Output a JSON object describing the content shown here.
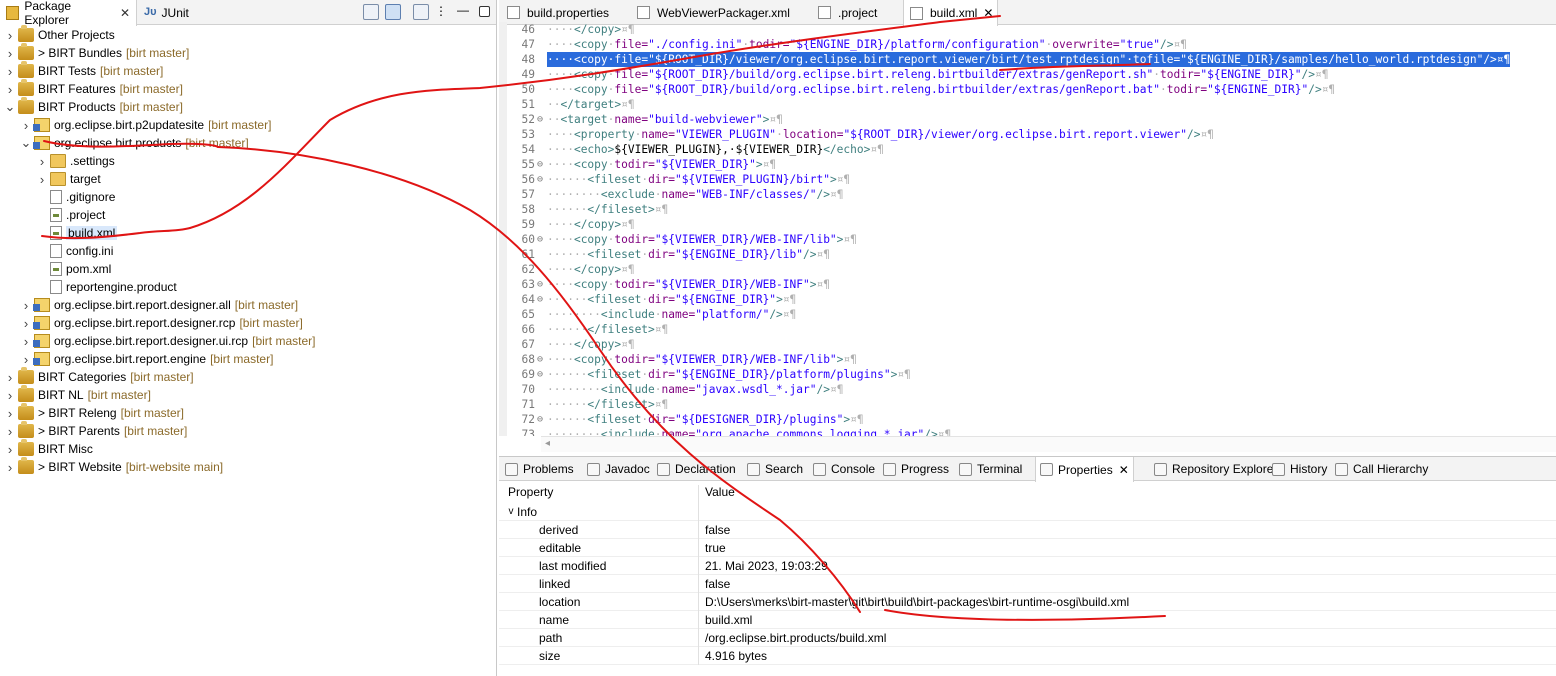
{
  "left_panel": {
    "tabs": [
      {
        "label": "Package Explorer",
        "active": true,
        "icon": "package-explorer-icon"
      },
      {
        "label": "JUnit",
        "active": false,
        "icon": "junit-icon"
      }
    ],
    "tree": [
      {
        "label": "Other Projects",
        "repo": "",
        "prefix": "",
        "level": 0,
        "arrow": ">",
        "icon": "ws"
      },
      {
        "label": "BIRT Bundles",
        "repo": "[birt master]",
        "prefix": "> ",
        "level": 0,
        "arrow": ">",
        "icon": "ws"
      },
      {
        "label": "BIRT Tests",
        "repo": "[birt master]",
        "prefix": "",
        "level": 0,
        "arrow": ">",
        "icon": "ws"
      },
      {
        "label": "BIRT Features",
        "repo": "[birt master]",
        "prefix": "",
        "level": 0,
        "arrow": ">",
        "icon": "ws"
      },
      {
        "label": "BIRT Products",
        "repo": "[birt master]",
        "prefix": "",
        "level": 0,
        "arrow": "v",
        "icon": "ws"
      },
      {
        "label": "org.eclipse.birt.p2updatesite",
        "repo": "[birt master]",
        "prefix": "",
        "level": 1,
        "arrow": ">",
        "icon": "proj"
      },
      {
        "label": "org.eclipse.birt.products",
        "repo": "[birt master]",
        "prefix": "",
        "level": 1,
        "arrow": "v",
        "icon": "proj"
      },
      {
        "label": ".settings",
        "repo": "",
        "prefix": "",
        "level": 2,
        "arrow": ">",
        "icon": "fold"
      },
      {
        "label": "target",
        "repo": "",
        "prefix": "",
        "level": 2,
        "arrow": ">",
        "icon": "fold"
      },
      {
        "label": ".gitignore",
        "repo": "",
        "prefix": "",
        "level": 2,
        "arrow": "",
        "icon": "file"
      },
      {
        "label": ".project",
        "repo": "",
        "prefix": "",
        "level": 2,
        "arrow": "",
        "icon": "xml"
      },
      {
        "label": "build.xml",
        "repo": "",
        "prefix": "",
        "level": 2,
        "arrow": "",
        "icon": "xml",
        "selected": true
      },
      {
        "label": "config.ini",
        "repo": "",
        "prefix": "",
        "level": 2,
        "arrow": "",
        "icon": "file"
      },
      {
        "label": "pom.xml",
        "repo": "",
        "prefix": "",
        "level": 2,
        "arrow": "",
        "icon": "xml"
      },
      {
        "label": "reportengine.product",
        "repo": "",
        "prefix": "",
        "level": 2,
        "arrow": "",
        "icon": "file"
      },
      {
        "label": "org.eclipse.birt.report.designer.all",
        "repo": "[birt master]",
        "prefix": "",
        "level": 1,
        "arrow": ">",
        "icon": "proj"
      },
      {
        "label": "org.eclipse.birt.report.designer.rcp",
        "repo": "[birt master]",
        "prefix": "",
        "level": 1,
        "arrow": ">",
        "icon": "proj"
      },
      {
        "label": "org.eclipse.birt.report.designer.ui.rcp",
        "repo": "[birt master]",
        "prefix": "",
        "level": 1,
        "arrow": ">",
        "icon": "proj"
      },
      {
        "label": "org.eclipse.birt.report.engine",
        "repo": "[birt master]",
        "prefix": "",
        "level": 1,
        "arrow": ">",
        "icon": "proj"
      },
      {
        "label": "BIRT Categories",
        "repo": "[birt master]",
        "prefix": "",
        "level": 0,
        "arrow": ">",
        "icon": "ws"
      },
      {
        "label": "BIRT NL",
        "repo": "[birt master]",
        "prefix": "",
        "level": 0,
        "arrow": ">",
        "icon": "ws"
      },
      {
        "label": "BIRT Releng",
        "repo": "[birt master]",
        "prefix": "> ",
        "level": 0,
        "arrow": ">",
        "icon": "ws"
      },
      {
        "label": "BIRT Parents",
        "repo": "[birt master]",
        "prefix": "> ",
        "level": 0,
        "arrow": ">",
        "icon": "ws"
      },
      {
        "label": "BIRT Misc",
        "repo": "",
        "prefix": "",
        "level": 0,
        "arrow": ">",
        "icon": "ws"
      },
      {
        "label": "BIRT Website",
        "repo": "[birt-website main]",
        "prefix": "> ",
        "level": 0,
        "arrow": ">",
        "icon": "ws"
      }
    ]
  },
  "editor": {
    "tabs": [
      {
        "label": "build.properties",
        "active": false
      },
      {
        "label": "WebViewerPackager.xml",
        "active": false
      },
      {
        "label": ".project",
        "active": false
      },
      {
        "label": "build.xml",
        "active": true
      }
    ],
    "lines": [
      {
        "n": "46",
        "fold": "",
        "ind": "····",
        "segs": [
          [
            "tg",
            "</copy>"
          ],
          [
            "ws",
            "¤¶"
          ]
        ]
      },
      {
        "n": "47",
        "fold": "",
        "ind": "····",
        "segs": [
          [
            "tg",
            "<copy"
          ],
          [
            "ws",
            "·"
          ],
          [
            "an",
            "file="
          ],
          [
            "av",
            "\"./config.ini\""
          ],
          [
            "ws",
            "·"
          ],
          [
            "an",
            "todir="
          ],
          [
            "av",
            "\"${ENGINE_DIR}/platform/configuration\""
          ],
          [
            "ws",
            "·"
          ],
          [
            "an",
            "overwrite="
          ],
          [
            "av",
            "\"true\""
          ],
          [
            "tg",
            "/>"
          ],
          [
            "ws",
            "¤¶"
          ]
        ]
      },
      {
        "n": "48",
        "fold": "",
        "ind": "····",
        "hl": true,
        "segs": [
          [
            "tg",
            "<copy"
          ],
          [
            "ws",
            "·"
          ],
          [
            "an",
            "file="
          ],
          [
            "av",
            "\"${ROOT_DIR}/viewer/org.eclipse.birt.report.viewer/birt/test.rptdesign\""
          ],
          [
            "ws",
            "·"
          ],
          [
            "an",
            "tofile="
          ],
          [
            "av",
            "\"${ENGINE_DIR}/samples/hello_world.rptdesign\""
          ],
          [
            "tg",
            "/>"
          ],
          [
            "ws",
            "¤¶"
          ]
        ]
      },
      {
        "n": "49",
        "fold": "",
        "ind": "····",
        "segs": [
          [
            "tg",
            "<copy"
          ],
          [
            "ws",
            "·"
          ],
          [
            "an",
            "file="
          ],
          [
            "av",
            "\"${ROOT_DIR}/build/org.eclipse.birt.releng.birtbuilder/extras/genReport.sh\""
          ],
          [
            "ws",
            "·"
          ],
          [
            "an",
            "todir="
          ],
          [
            "av",
            "\"${ENGINE_DIR}\""
          ],
          [
            "tg",
            "/>"
          ],
          [
            "ws",
            "¤¶"
          ]
        ]
      },
      {
        "n": "50",
        "fold": "",
        "ind": "····",
        "segs": [
          [
            "tg",
            "<copy"
          ],
          [
            "ws",
            "·"
          ],
          [
            "an",
            "file="
          ],
          [
            "av",
            "\"${ROOT_DIR}/build/org.eclipse.birt.releng.birtbuilder/extras/genReport.bat\""
          ],
          [
            "ws",
            "·"
          ],
          [
            "an",
            "todir="
          ],
          [
            "av",
            "\"${ENGINE_DIR}\""
          ],
          [
            "tg",
            "/>"
          ],
          [
            "ws",
            "¤¶"
          ]
        ]
      },
      {
        "n": "51",
        "fold": "",
        "ind": "··",
        "segs": [
          [
            "tg",
            "</target>"
          ],
          [
            "ws",
            "¤¶"
          ]
        ]
      },
      {
        "n": "52",
        "fold": "⊖",
        "ind": "··",
        "segs": [
          [
            "tg",
            "<target"
          ],
          [
            "ws",
            "·"
          ],
          [
            "an",
            "name="
          ],
          [
            "av",
            "\"build-webviewer\""
          ],
          [
            "tg",
            ">"
          ],
          [
            "ws",
            "¤¶"
          ]
        ]
      },
      {
        "n": "53",
        "fold": "",
        "ind": "····",
        "segs": [
          [
            "tg",
            "<property"
          ],
          [
            "ws",
            "·"
          ],
          [
            "an",
            "name="
          ],
          [
            "av",
            "\"VIEWER_PLUGIN\""
          ],
          [
            "ws",
            "·"
          ],
          [
            "an",
            "location="
          ],
          [
            "av",
            "\"${ROOT_DIR}/viewer/org.eclipse.birt.report.viewer\""
          ],
          [
            "tg",
            "/>"
          ],
          [
            "ws",
            "¤¶"
          ]
        ]
      },
      {
        "n": "54",
        "fold": "",
        "ind": "····",
        "segs": [
          [
            "tg",
            "<echo>"
          ],
          [
            "",
            "${VIEWER_PLUGIN},·${VIEWER_DIR}"
          ],
          [
            "tg",
            "</echo>"
          ],
          [
            "ws",
            "¤¶"
          ]
        ]
      },
      {
        "n": "55",
        "fold": "⊖",
        "ind": "····",
        "segs": [
          [
            "tg",
            "<copy"
          ],
          [
            "ws",
            "·"
          ],
          [
            "an",
            "todir="
          ],
          [
            "av",
            "\"${VIEWER_DIR}\""
          ],
          [
            "tg",
            ">"
          ],
          [
            "ws",
            "¤¶"
          ]
        ]
      },
      {
        "n": "56",
        "fold": "⊖",
        "ind": "······",
        "segs": [
          [
            "tg",
            "<fileset"
          ],
          [
            "ws",
            "·"
          ],
          [
            "an",
            "dir="
          ],
          [
            "av",
            "\"${VIEWER_PLUGIN}/birt\""
          ],
          [
            "tg",
            ">"
          ],
          [
            "ws",
            "¤¶"
          ]
        ]
      },
      {
        "n": "57",
        "fold": "",
        "ind": "········",
        "segs": [
          [
            "tg",
            "<exclude"
          ],
          [
            "ws",
            "·"
          ],
          [
            "an",
            "name="
          ],
          [
            "av",
            "\"WEB-INF/classes/\""
          ],
          [
            "tg",
            "/>"
          ],
          [
            "ws",
            "¤¶"
          ]
        ]
      },
      {
        "n": "58",
        "fold": "",
        "ind": "······",
        "segs": [
          [
            "tg",
            "</fileset>"
          ],
          [
            "ws",
            "¤¶"
          ]
        ]
      },
      {
        "n": "59",
        "fold": "",
        "ind": "····",
        "segs": [
          [
            "tg",
            "</copy>"
          ],
          [
            "ws",
            "¤¶"
          ]
        ]
      },
      {
        "n": "60",
        "fold": "⊖",
        "ind": "····",
        "segs": [
          [
            "tg",
            "<copy"
          ],
          [
            "ws",
            "·"
          ],
          [
            "an",
            "todir="
          ],
          [
            "av",
            "\"${VIEWER_DIR}/WEB-INF/lib\""
          ],
          [
            "tg",
            ">"
          ],
          [
            "ws",
            "¤¶"
          ]
        ]
      },
      {
        "n": "61",
        "fold": "",
        "ind": "······",
        "segs": [
          [
            "tg",
            "<fileset"
          ],
          [
            "ws",
            "·"
          ],
          [
            "an",
            "dir="
          ],
          [
            "av",
            "\"${ENGINE_DIR}/lib\""
          ],
          [
            "tg",
            "/>"
          ],
          [
            "ws",
            "¤¶"
          ]
        ]
      },
      {
        "n": "62",
        "fold": "",
        "ind": "····",
        "segs": [
          [
            "tg",
            "</copy>"
          ],
          [
            "ws",
            "¤¶"
          ]
        ]
      },
      {
        "n": "63",
        "fold": "⊖",
        "ind": "····",
        "segs": [
          [
            "tg",
            "<copy"
          ],
          [
            "ws",
            "·"
          ],
          [
            "an",
            "todir="
          ],
          [
            "av",
            "\"${VIEWER_DIR}/WEB-INF\""
          ],
          [
            "tg",
            ">"
          ],
          [
            "ws",
            "¤¶"
          ]
        ]
      },
      {
        "n": "64",
        "fold": "⊖",
        "ind": "······",
        "segs": [
          [
            "tg",
            "<fileset"
          ],
          [
            "ws",
            "·"
          ],
          [
            "an",
            "dir="
          ],
          [
            "av",
            "\"${ENGINE_DIR}\""
          ],
          [
            "tg",
            ">"
          ],
          [
            "ws",
            "¤¶"
          ]
        ]
      },
      {
        "n": "65",
        "fold": "",
        "ind": "········",
        "segs": [
          [
            "tg",
            "<include"
          ],
          [
            "ws",
            "·"
          ],
          [
            "an",
            "name="
          ],
          [
            "av",
            "\"platform/\""
          ],
          [
            "tg",
            "/>"
          ],
          [
            "ws",
            "¤¶"
          ]
        ]
      },
      {
        "n": "66",
        "fold": "",
        "ind": "······",
        "segs": [
          [
            "tg",
            "</fileset>"
          ],
          [
            "ws",
            "¤¶"
          ]
        ]
      },
      {
        "n": "67",
        "fold": "",
        "ind": "····",
        "segs": [
          [
            "tg",
            "</copy>"
          ],
          [
            "ws",
            "¤¶"
          ]
        ]
      },
      {
        "n": "68",
        "fold": "⊖",
        "ind": "····",
        "segs": [
          [
            "tg",
            "<copy"
          ],
          [
            "ws",
            "·"
          ],
          [
            "an",
            "todir="
          ],
          [
            "av",
            "\"${VIEWER_DIR}/WEB-INF/lib\""
          ],
          [
            "tg",
            ">"
          ],
          [
            "ws",
            "¤¶"
          ]
        ]
      },
      {
        "n": "69",
        "fold": "⊖",
        "ind": "······",
        "segs": [
          [
            "tg",
            "<fileset"
          ],
          [
            "ws",
            "·"
          ],
          [
            "an",
            "dir="
          ],
          [
            "av",
            "\"${ENGINE_DIR}/platform/plugins\""
          ],
          [
            "tg",
            ">"
          ],
          [
            "ws",
            "¤¶"
          ]
        ]
      },
      {
        "n": "70",
        "fold": "",
        "ind": "········",
        "segs": [
          [
            "tg",
            "<include"
          ],
          [
            "ws",
            "·"
          ],
          [
            "an",
            "name="
          ],
          [
            "av",
            "\"javax.wsdl_*.jar\""
          ],
          [
            "tg",
            "/>"
          ],
          [
            "ws",
            "¤¶"
          ]
        ]
      },
      {
        "n": "71",
        "fold": "",
        "ind": "······",
        "segs": [
          [
            "tg",
            "</fileset>"
          ],
          [
            "ws",
            "¤¶"
          ]
        ]
      },
      {
        "n": "72",
        "fold": "⊖",
        "ind": "······",
        "segs": [
          [
            "tg",
            "<fileset"
          ],
          [
            "ws",
            "·"
          ],
          [
            "an",
            "dir="
          ],
          [
            "av",
            "\"${DESIGNER_DIR}/plugins\""
          ],
          [
            "tg",
            ">"
          ],
          [
            "ws",
            "¤¶"
          ]
        ]
      },
      {
        "n": "73",
        "fold": "",
        "ind": "········",
        "segs": [
          [
            "tg",
            "<include"
          ],
          [
            "ws",
            "·"
          ],
          [
            "an",
            "name="
          ],
          [
            "av",
            "\"org.apache.commons.logging_*.jar\""
          ],
          [
            "tg",
            "/>"
          ],
          [
            "ws",
            "¤¶"
          ]
        ]
      }
    ]
  },
  "bottom_panel": {
    "tabs": [
      {
        "label": "Problems",
        "active": false
      },
      {
        "label": "Javadoc",
        "active": false
      },
      {
        "label": "Declaration",
        "active": false
      },
      {
        "label": "Search",
        "active": false
      },
      {
        "label": "Console",
        "active": false
      },
      {
        "label": "Progress",
        "active": false
      },
      {
        "label": "Terminal",
        "active": false
      },
      {
        "label": "Properties",
        "active": true
      },
      {
        "label": "Repository Explorer",
        "active": false
      },
      {
        "label": "History",
        "active": false
      },
      {
        "label": "Call Hierarchy",
        "active": false
      }
    ],
    "headers": {
      "property": "Property",
      "value": "Value"
    },
    "category": "Info",
    "rows": [
      {
        "property": "derived",
        "value": "false"
      },
      {
        "property": "editable",
        "value": "true"
      },
      {
        "property": "last modified",
        "value": "21. Mai 2023, 19:03:29"
      },
      {
        "property": "linked",
        "value": "false"
      },
      {
        "property": "location",
        "value": "D:\\Users\\merks\\birt-master\\git\\birt\\build\\birt-packages\\birt-runtime-osgi\\build.xml"
      },
      {
        "property": "name",
        "value": "build.xml"
      },
      {
        "property": "path",
        "value": "/org.eclipse.birt.products/build.xml"
      },
      {
        "property": "size",
        "value": "4.916  bytes"
      }
    ]
  },
  "colors": {
    "annotation": "#e01414",
    "selection": "#2a6bdc",
    "xml_tag": "#3f7f7f",
    "xml_attr": "#7f007f",
    "xml_value": "#2a00ff",
    "git_label": "#8b6a2a"
  }
}
